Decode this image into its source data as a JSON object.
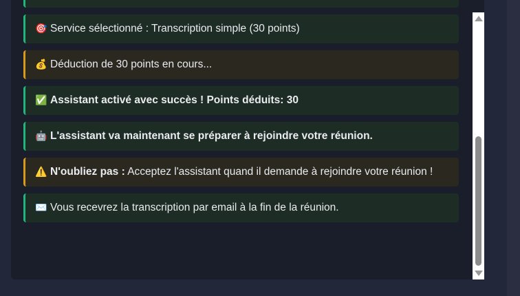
{
  "messages": [
    {
      "type": "success",
      "icon": "🎯",
      "icon_name": "target-icon",
      "text": "Service sélectionné : Transcription simple (30 points)"
    },
    {
      "type": "warning",
      "icon": "💰",
      "icon_name": "money-bag-icon",
      "text": "Déduction de 30 points en cours..."
    },
    {
      "type": "success",
      "icon": "✅",
      "icon_name": "check-icon",
      "bold": "Assistant activé avec succès ! Points déduits: 30"
    },
    {
      "type": "success",
      "icon": "🤖",
      "icon_name": "robot-icon",
      "bold": "L'assistant va maintenant se préparer à rejoindre votre réunion."
    },
    {
      "type": "warning",
      "icon": "⚠️",
      "icon_name": "warning-icon",
      "bold": "N'oubliez pas :",
      "text": " Acceptez l'assistant quand il demande à rejoindre votre réunion !"
    },
    {
      "type": "success",
      "icon": "✉️",
      "icon_name": "envelope-icon",
      "text": "Vous recevrez la transcription par email à la fin de la réunion."
    }
  ],
  "colors": {
    "success_border": "#1fb77e",
    "warning_border": "#d99a1a",
    "panel_bg": "#1a1d2a",
    "page_bg": "#23273a"
  },
  "scroll": {
    "position": "bottom"
  }
}
